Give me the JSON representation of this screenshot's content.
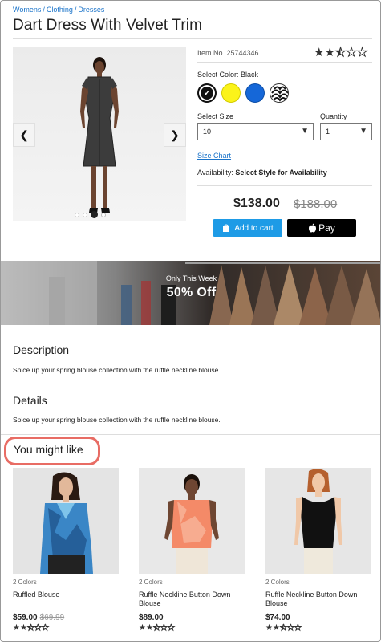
{
  "breadcrumb": [
    "Womens",
    "Clothing",
    "Dresses"
  ],
  "title": "Dart Dress With Velvet Trim",
  "item_no": "Item No. 25744346",
  "rating": {
    "filled": 2,
    "half": 1,
    "empty": 2
  },
  "select_color_label": "Select Color: Black",
  "colors": [
    "black",
    "yellow",
    "blue",
    "pattern"
  ],
  "select_size_label": "Select Size",
  "size_value": "10",
  "quantity_label": "Quantity",
  "quantity_value": "1",
  "size_chart": "Size Chart",
  "availability_label": "Availability:",
  "availability_value": "Select Style for Availability",
  "price": "$138.00",
  "old_price": "$188.00",
  "add_to_cart": "Add to cart",
  "apple_pay": "Pay",
  "banner": {
    "line1": "Only This Week",
    "line2": "50% Off"
  },
  "description": {
    "title": "Description",
    "text": "Spice up your spring blouse collection with the ruffle neckline blouse."
  },
  "details": {
    "title": "Details",
    "text": "Spice up your spring blouse collection with the ruffle neckline blouse."
  },
  "you_might_like": "You might like",
  "products": [
    {
      "colors": "2 Colors",
      "name": "Ruffled Blouse",
      "price": "$59.00",
      "old_price": "$69.99"
    },
    {
      "colors": "2 Colors",
      "name": "Ruffle Neckline Button Down Blouse",
      "price": "$89.00",
      "old_price": ""
    },
    {
      "colors": "2 Colors",
      "name": "Ruffle Neckline Button Down Blouse",
      "price": "$74.00",
      "old_price": ""
    }
  ],
  "accent_color": "#1e9be6",
  "highlight_color": "#e86c64"
}
